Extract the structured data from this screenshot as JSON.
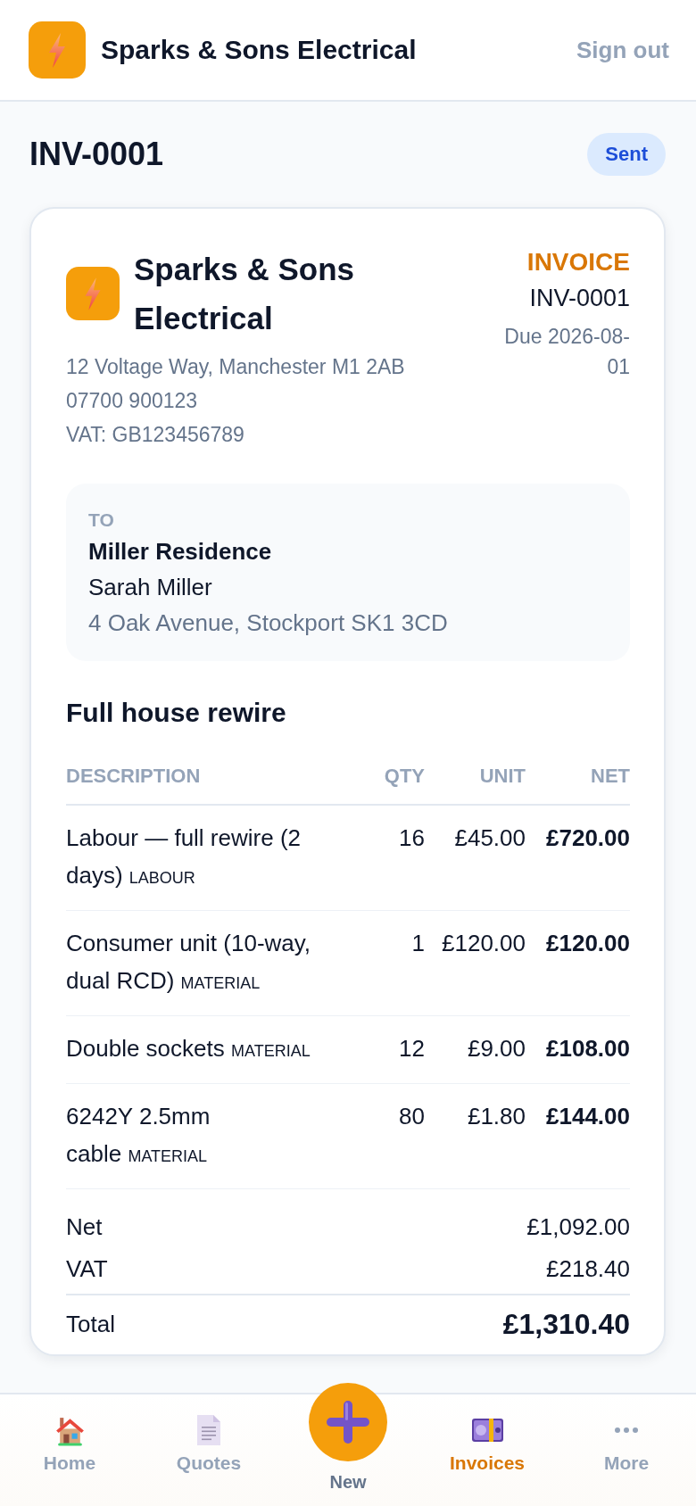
{
  "header": {
    "title": "Sparks & Sons Electrical",
    "sign_out": "Sign out"
  },
  "page": {
    "title": "INV-0001",
    "status": {
      "label": "Sent",
      "kind": "sent"
    }
  },
  "invoice": {
    "company": {
      "name": "Sparks & Sons Electrical",
      "address": "12 Voltage Way, Manchester M1 2AB",
      "phone": "07700 900123",
      "vat": "VAT: GB123456789"
    },
    "document": {
      "type": "INVOICE",
      "number": "INV-0001",
      "due": "Due 2026-08-01"
    },
    "recipient": {
      "label": "TO",
      "name": "Miller Residence",
      "contact": "Sarah Miller",
      "address": "4 Oak Avenue, Stockport SK1 3CD"
    },
    "job_title": "Full house rewire",
    "table": {
      "columns": [
        "DESCRIPTION",
        "QTY",
        "UNIT",
        "NET"
      ],
      "rows": [
        {
          "description": "Labour — full rewire (2 days)",
          "tag": "LABOUR",
          "qty": "16",
          "unit": "£45.00",
          "net": "£720.00"
        },
        {
          "description": "Consumer unit (10-way, dual RCD)",
          "tag": "MATERIAL",
          "qty": "1",
          "unit": "£120.00",
          "net": "£120.00"
        },
        {
          "description": "Double sockets",
          "tag": "MATERIAL",
          "qty": "12",
          "unit": "£9.00",
          "net": "£108.00"
        },
        {
          "description": "6242Y 2.5mm cable",
          "tag": "MATERIAL",
          "qty": "80",
          "unit": "£1.80",
          "net": "£144.00"
        }
      ]
    },
    "totals": [
      {
        "label": "Net",
        "value": "£1,092.00",
        "kind": "line"
      },
      {
        "label": "VAT",
        "value": "£218.40",
        "kind": "line"
      },
      {
        "label": "Total",
        "value": "£1,310.40",
        "kind": "total"
      }
    ]
  },
  "bottom_nav": [
    {
      "label": "Home",
      "kind": "tab",
      "selected": false
    },
    {
      "label": "Quotes",
      "kind": "tab",
      "selected": false
    },
    {
      "label": "New",
      "kind": "action",
      "selected": false
    },
    {
      "label": "Invoices",
      "kind": "tab",
      "selected": true
    },
    {
      "label": "More",
      "kind": "tab",
      "selected": false
    }
  ]
}
